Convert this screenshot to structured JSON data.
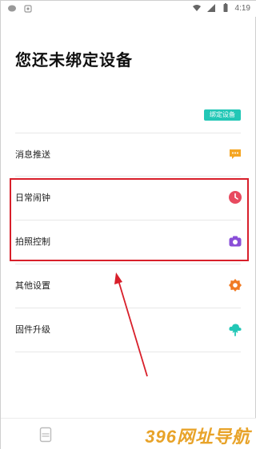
{
  "status_bar": {
    "time": "4:19",
    "icons": [
      "chat-bubble-icon",
      "app-notification-icon",
      "wifi-icon",
      "signal-icon",
      "battery-icon"
    ]
  },
  "page": {
    "title": "您还未绑定设备"
  },
  "bind_button": {
    "label": "绑定设备",
    "color": "#22c7b6"
  },
  "menu": {
    "items": [
      {
        "label": "消息推送",
        "icon": "message-icon",
        "color": "#f5a623"
      },
      {
        "label": "日常闹钟",
        "icon": "clock-icon",
        "color": "#e84a5f"
      },
      {
        "label": "拍照控制",
        "icon": "camera-icon",
        "color": "#8a4fd8"
      },
      {
        "label": "其他设置",
        "icon": "settings-gear-icon",
        "color": "#f07a23"
      },
      {
        "label": "固件升级",
        "icon": "upload-cloud-icon",
        "color": "#22c7b6"
      }
    ]
  },
  "annotation": {
    "highlight_color": "#d81f2a"
  },
  "bottom_nav": {
    "tab_icon": "device-tab-icon"
  },
  "watermark": {
    "text": "396网址导航"
  }
}
